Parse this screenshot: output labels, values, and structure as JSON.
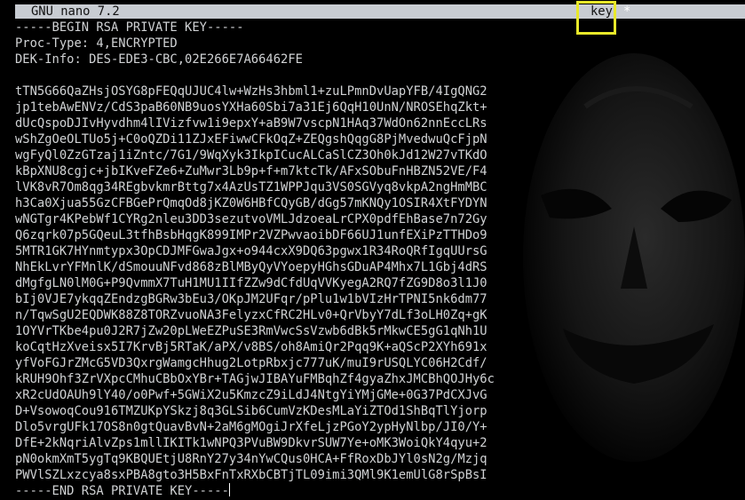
{
  "title_bar": {
    "app_name": "GNU nano 7.2",
    "filename": "key",
    "modified_flag": "*"
  },
  "colors": {
    "background": "#000000",
    "text": "#d0d2d4",
    "title_bar_bg": "#c8ccd2",
    "highlight_box": "#e8e82a"
  },
  "editor": {
    "header_lines": [
      "-----BEGIN RSA PRIVATE KEY-----",
      "Proc-Type: 4,ENCRYPTED",
      "DEK-Info: DES-EDE3-CBC,02E266E7A66462FE",
      ""
    ],
    "body_lines": [
      "tTN5G66QaZHsjOSYG8pFEQqUJUC4lw+WzHs3hbml1+zuLPmnDvUapYFB/4IgQNG2",
      "jp1tebAwENVz/CdS3paB60NB9uosYXHa60Sbi7a31Ej6QqH10UnN/NROSEhqZkt+",
      "dUcQspoDJIvHyvdhm4lIVizfvw1i9epxY+aB9W7vscpN1HAq37WdOn62nnEccLRs",
      "wShZgOeOLTUo5j+C0oQZDi11ZJxEFiwwCFkOqZ+ZEQgshQqgG8PjMvedwuQcFjpN",
      "wgFyQl0ZzGTzaj1iZntc/7G1/9WqXyk3IkpICucALCaSlCZ3Oh0kJd12W27vTKdO",
      "kBpXNU8cgjc+jbIKveFZe6+ZuMwr3Lb9p+f+m7ktcTk/AFxSObuFnHBZN52VE/F4",
      "lVK8vR7Om8qg34REgbvkmrBttg7x4AzUsTZ1WPPJqu3VS0SGVyq8vkpA2ngHmMBC",
      "h3Ca0Xjua55GzCFBGePrQmqOd8jKZ0W6HBfCQyGB/dGg57mKNQy1OSIR4XtFYDYN",
      "wNGTgr4KPebWf1CYRg2nleu3DD3sezutvoVMLJdzoeaLrCPX0pdfEhBase7n72Gy",
      "Q6zqrk07p5GQeuL3tfhBsbHqgK899IMPr2VZPwvaoibDF66UJ1unfEXiPzTTHDo9",
      "5MTR1GK7HYnmtypx3OpCDJMFGwaJgx+o944cxX9DQ63pgwx1R34RoQRfIgqUUrsG",
      "NhEkLvrYFMnlK/dSmouuNFvd868zBlMByQyVYoepyHGhsGDuAP4Mhx7L1Gbj4dRS",
      "dMgfgLN0lM0G+P9QvmmX7TuH1MU1IIfZZw9dCfdUqVVKyegA2RQ7fZG9D8o3l1J0",
      "bIj0VJE7ykqqZEndzgBGRw3bEu3/OKpJM2UFqr/pPlu1w1bVIzHrTPNI5nk6dm77",
      "n/TqwSgU2EQDWK88Z8TORZvuoNA3FelyzxCfRC2HLv0+QrVbyY7dLf3oLH0Zq+gK",
      "1OYVrTKbe4pu0J2R7jZw20pLWeEZPuSE3RmVwcSsVzwb6dBk5rMkwCE5gG1qNh1U",
      "koCqtHzXveisx5I7KrvBj5RTaK/aPX/v8BS/oh8AmiQr2Pqq9K+aQScP2XYh691x",
      "yfVoFGJrZMcG5VD3QxrgWamgcHhug2LotpRbxjc777uK/muI9rUSQLYC06H2Cdf/",
      "kRUH9Ohf3ZrVXpcCMhuCBbOxYBr+TAGjwJIBAYuFMBqhZf4gyaZhxJMCBhQOJHy6c",
      "xR2cUdOAUh9lY40/o0Pwf+5GWiX2u5KmzcZ9iLdJ4NtgYiYMjGMe+0G37PdCXJvG",
      "D+VsowoqCou916TMZUKpYSkzj8q3GLSib6CumVzKDesMLaYiZTOd1ShBqTlYjorp",
      "Dlo5vrgUFk17OS8n0gtQuavBvN+2aM6gMOgiJrXfeLjzPGoY2ypHyNlbp/JI0/Y+",
      "DfE+2kNqriAlvZps1mllIKITk1wNPQ3PVuBW9DkvrSUW7Ye+oMK3WoiQkY4qyu+2",
      "pN0okmXmT5ygTq9KBQUEtjU8RnY27y34nYwCQus0HCA+FfRoxDbJYl0sN2g/Mzjq",
      "PWVlSZLxzcya8sxPBA8gto3H5BxFnTxRXbCBTjTL09imi3QMl9K1emUlG8rSpBsI"
    ],
    "footer_line": "-----END RSA PRIVATE KEY-----"
  }
}
